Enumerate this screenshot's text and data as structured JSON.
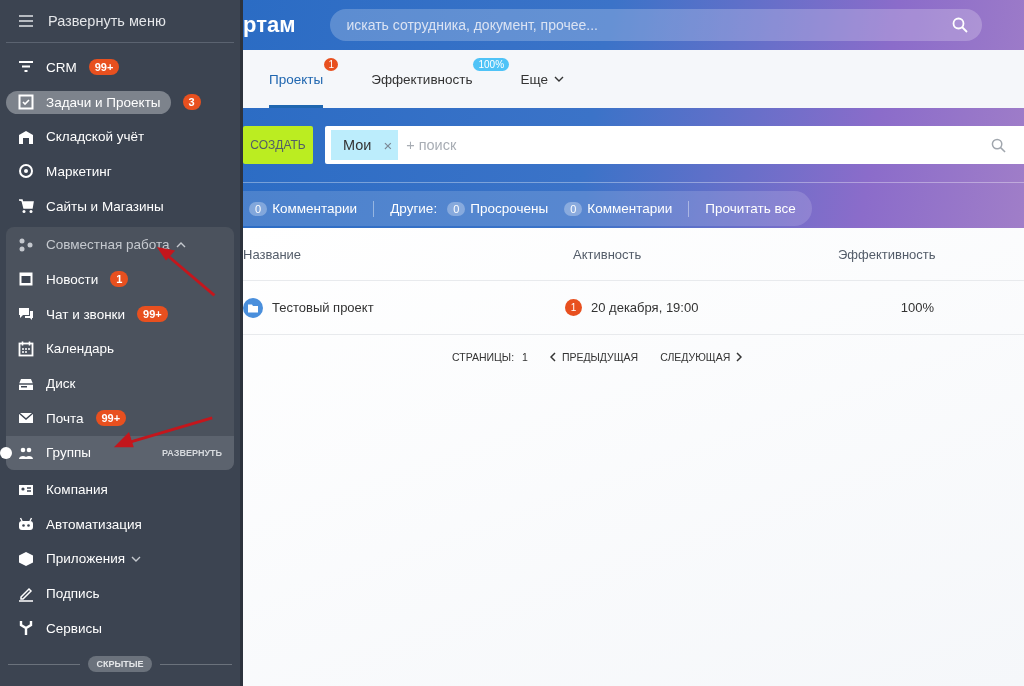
{
  "sidebar": {
    "menu_toggle": "Развернуть меню",
    "items": [
      {
        "label": "CRM",
        "badge": "99+",
        "selected": false
      },
      {
        "label": "Задачи и Проекты",
        "badge": "3",
        "selected": true
      },
      {
        "label": "Складской учёт",
        "selected": false
      },
      {
        "label": "Маркетинг",
        "selected": false
      },
      {
        "label": "Сайты и Магазины",
        "selected": false
      },
      {
        "label": "Совместная работа",
        "selected": false,
        "expanded": true,
        "children": [
          {
            "label": "Новости",
            "badge": "1",
            "selected": false
          },
          {
            "label": "Чат и звонки",
            "badge": "99+",
            "selected": false
          },
          {
            "label": "Календарь",
            "selected": false
          },
          {
            "label": "Диск",
            "selected": false
          },
          {
            "label": "Почта",
            "badge": "99+",
            "selected": false
          },
          {
            "label": "Группы",
            "selected": false,
            "hovered": true,
            "action": "РАЗВЕРНУТЬ"
          }
        ]
      },
      {
        "label": "Компания",
        "selected": false
      },
      {
        "label": "Автоматизация",
        "selected": false
      },
      {
        "label": "Приложения",
        "selected": false,
        "expanded": false
      },
      {
        "label": "Подпись",
        "selected": false
      },
      {
        "label": "Сервисы",
        "selected": false
      }
    ],
    "hidden_label": "СКРЫТЫЕ"
  },
  "header": {
    "title": "ртам",
    "search": {
      "placeholder": "искать сотрудника, документ, прочее..."
    }
  },
  "tabs": [
    {
      "label": "Проекты",
      "selected": true,
      "badge": {
        "text": "1",
        "color": "#e8501f"
      }
    },
    {
      "label": "Эффективность",
      "selected": false,
      "badge": {
        "text": "100%",
        "color": "#4fc3f7"
      }
    },
    {
      "label": "Еще",
      "selected": false,
      "dropdown": true
    }
  ],
  "toolbar": {
    "create_button": "СОЗДАТЬ",
    "filter": {
      "chip": "Мои",
      "chip_remove": "×",
      "placeholder": "+ поиск"
    }
  },
  "counters": {
    "groups": [
      {
        "items": [
          {
            "count": "0",
            "label": "Комментарии"
          }
        ]
      },
      {
        "label": "Другие:",
        "items": [
          {
            "count": "0",
            "label": "Просрочены"
          },
          {
            "count": "0",
            "label": "Комментарии"
          }
        ]
      }
    ],
    "read_all": "Прочитать все"
  },
  "table": {
    "columns": [
      "Название",
      "Активность",
      "Эффективность"
    ],
    "rows": [
      {
        "name": "Тестовый проект",
        "activity_count": "1",
        "activity": "20 декабря, 19:00",
        "efficiency": "100%"
      }
    ]
  },
  "pagination": {
    "pages_label": "СТРАНИЦЫ:",
    "page": "1",
    "prev": "ПРЕДЫДУЩАЯ",
    "next": "СЛЕДУЮЩАЯ"
  }
}
